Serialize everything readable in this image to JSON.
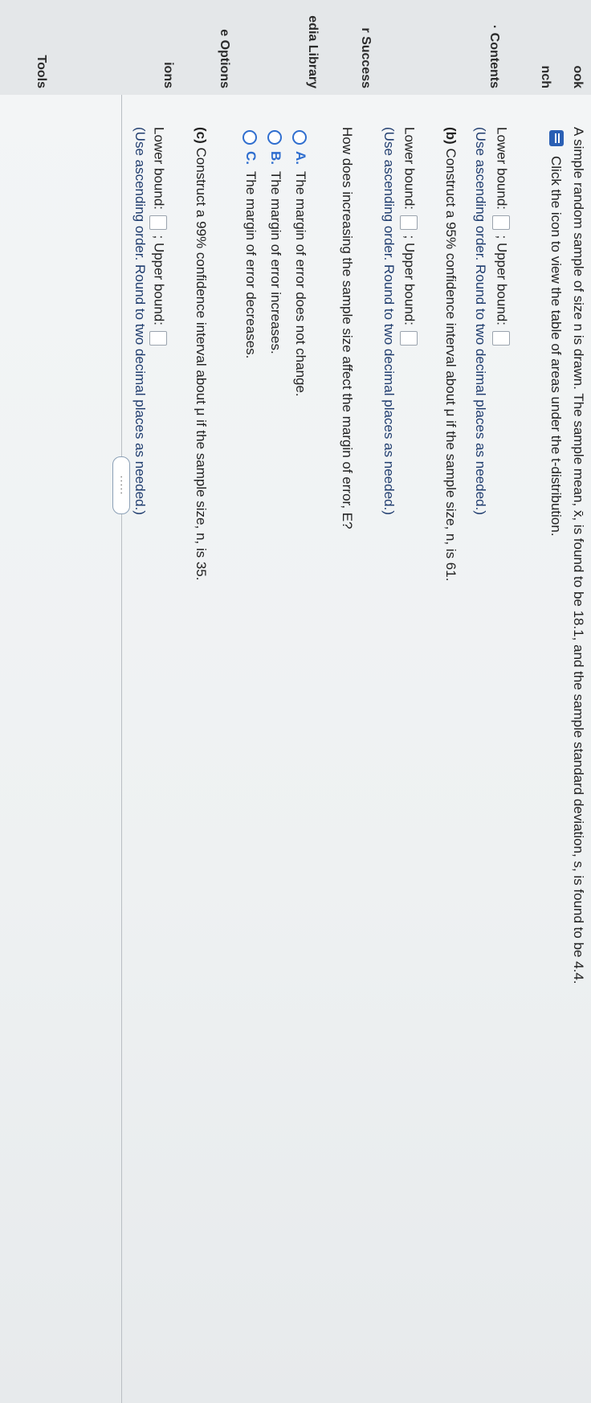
{
  "sidebar": {
    "items": [
      {
        "label": "ook"
      },
      {
        "label": "nch"
      },
      {
        "label": "· Contents"
      },
      {
        "label": "r Success"
      },
      {
        "label": "edia Library"
      },
      {
        "label": "e Options"
      },
      {
        "label": "ions"
      },
      {
        "label": "Tools"
      }
    ]
  },
  "problem": {
    "intro": "A simple random sample of size n is drawn. The sample mean, x̄, is found to be 18.1, and the sample standard deviation, s, is found to be 4.4.",
    "table_link": "Click the icon to view the table of areas under the t-distribution."
  },
  "more_button": "·····",
  "part_a": {
    "lower_label": "Lower bound:",
    "upper_label": "; Upper bound:",
    "note": "(Use ascending order. Round to two decimal places as needed.)"
  },
  "part_b": {
    "letter": "(b)",
    "question": "Construct a 95% confidence interval about μ if the sample size, n, is 61.",
    "lower_label": "Lower bound:",
    "upper_label": "; Upper bound:",
    "note": "(Use ascending order. Round to two decimal places as needed.)"
  },
  "effect_question": "How does increasing the sample size affect the margin of error, E?",
  "options": [
    {
      "letter": "A.",
      "text": "The margin of error does not change."
    },
    {
      "letter": "B.",
      "text": "The margin of error increases."
    },
    {
      "letter": "C.",
      "text": "The margin of error decreases."
    }
  ],
  "part_c": {
    "letter": "(c)",
    "question": "Construct a 99% confidence interval about μ if the sample size, n, is 35.",
    "lower_label": "Lower bound:",
    "upper_label": "; Upper bound:",
    "note": "(Use ascending order. Round to two decimal places as needed.)"
  }
}
